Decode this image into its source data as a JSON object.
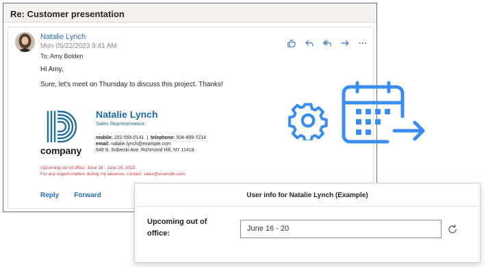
{
  "window": {
    "subject": "Re: Customer presentation"
  },
  "message": {
    "sender_name": "Natalie Lynch",
    "sent_date": "Mon 05/22/2023 9:41 AM",
    "to_line": "To:  Amy Bolden",
    "greeting": "Hi Amy,",
    "body": "Sure, let's meet on Thursday to discuss this project. Thanks!",
    "actions": [
      "like-icon",
      "reply-icon",
      "reply-all-icon",
      "forward-icon",
      "more-icon"
    ]
  },
  "signature": {
    "logo_text": "company",
    "name": "Natalie Lynch",
    "title": "Sales Representative",
    "mobile_label": "mobile:",
    "mobile": "202-555-0141",
    "separator": "|",
    "telephone_label": "telephone:",
    "telephone": "504-899-7214",
    "email_label": "email:",
    "email": "natalie.lynch@example.com",
    "address": "648 S. Sobieski Ave. Richmond Hill, NY 11418",
    "ooo_line1": "Upcoming out of office: June 16 - June 20, 2023.",
    "ooo_line2": "For any urgent matters during my absence, contact: sales@example.com."
  },
  "footer": {
    "reply_label": "Reply",
    "forward_label": "Forward"
  },
  "graphics": {
    "accent_color": "#3a8cf0",
    "icons": [
      "gear-icon",
      "calendar-forward-icon"
    ]
  },
  "info_panel": {
    "title": "User info for Natalie Lynch (Example)",
    "field_label": "Upcoming out of office:",
    "field_value": "June 16 - 20"
  },
  "colors": {
    "link": "#2b6cb8",
    "brand": "#1c6aa5",
    "warning": "#d13438"
  }
}
